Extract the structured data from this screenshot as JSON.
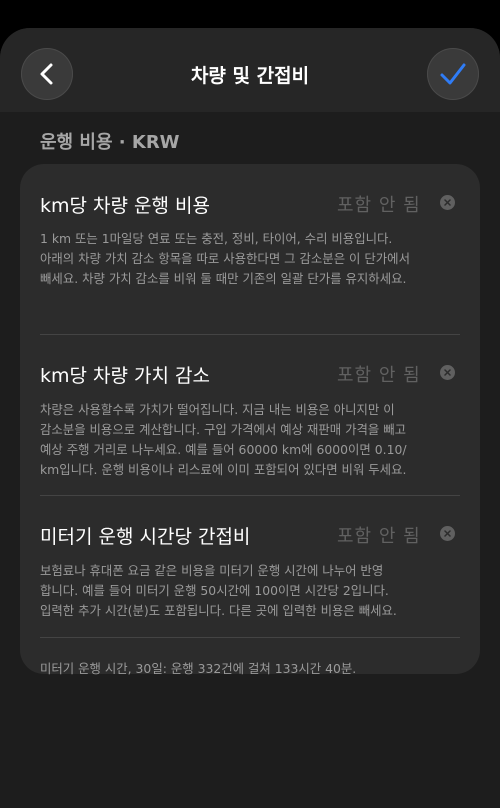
{
  "nav": {
    "title": "차량 및 간접비",
    "back_icon": "chevron-left-icon",
    "confirm_icon": "checkmark-icon",
    "accent_color": "#2f7cf6"
  },
  "section": {
    "header": "운행 비용 · KRW"
  },
  "rows": [
    {
      "title": "km당 차량 운행 비용",
      "value": "포함 안 됨",
      "description": [
        "1 km 또는 1마일당 연료 또는 충전, 정비, 타이어, 수리 비용입니다.",
        "아래의 차량 가치 감소 항목을 따로 사용한다면 그 감소분은 이 단가에서",
        "빼세요. 차량 가치 감소를 비워 둘 때만 기존의 일괄 단가를 유지하세요."
      ]
    },
    {
      "title": "km당 차량 가치 감소",
      "value": "포함 안 됨",
      "description": [
        "차량은 사용할수록 가치가 떨어집니다. 지금 내는 비용은 아니지만 이",
        "감소분을 비용으로 계산합니다. 구입 가격에서 예상 재판매 가격을 빼고",
        "예상 주행 거리로 나누세요. 예를 들어 60000 km에 6000이면 0.10/",
        "km입니다. 운행 비용이나 리스료에 이미 포함되어 있다면 비워 두세요."
      ]
    },
    {
      "title": "미터기 운행 시간당 간접비",
      "value": "포함 안 됨",
      "description": [
        "보험료나 휴대폰 요금 같은 비용을 미터기 운행 시간에 나누어 반영",
        "합니다. 예를 들어 미터기 운행 50시간에 100이면 시간당 2입니다.",
        "입력한 추가 시간(분)도 포함됩니다. 다른 곳에 입력한 비용은 빼세요."
      ]
    }
  ],
  "footer": "미터기 운행 시간, 30일: 운행 332건에 걸쳐 133시간 40분."
}
